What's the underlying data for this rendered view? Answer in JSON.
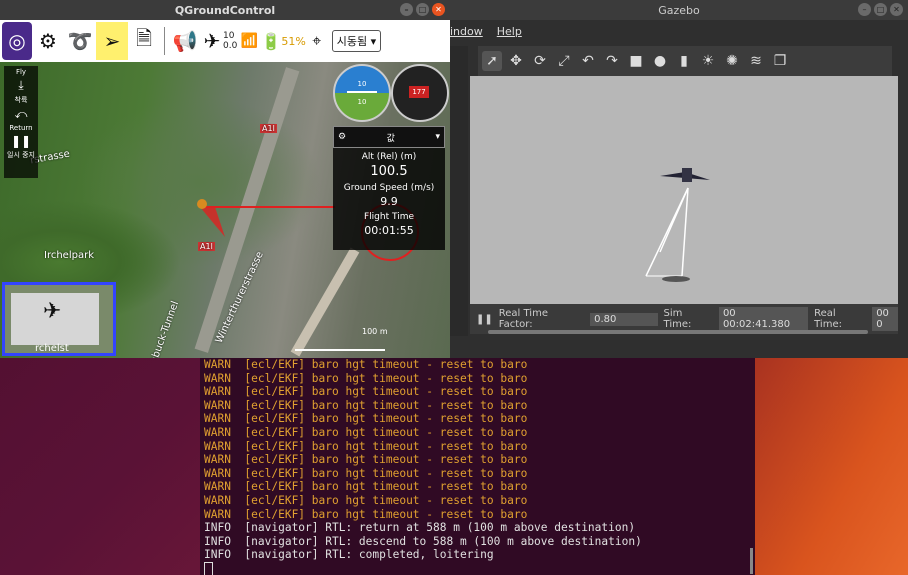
{
  "qgc": {
    "title": "QGroundControl",
    "toolbar": {
      "sat_count": "10",
      "hdop": "0.0",
      "battery": "51%",
      "mode": "시동됨"
    },
    "fly_panel": {
      "fly": "Fly",
      "takeoff": "착륙",
      "return": "Return",
      "pause": "일시 중지"
    },
    "values": {
      "header": "값",
      "alt_label": "Alt (Rel) (m)",
      "alt_value": "100.5",
      "speed_label": "Ground Speed (m/s)",
      "speed_value": "9.9",
      "time_label": "Flight Time",
      "time_value": "00:01:55"
    },
    "attitude": {
      "top": "10",
      "bottom": "10"
    },
    "compass": {
      "heading": "177"
    },
    "map_labels": {
      "street1": "rstrasse",
      "park": "Irchelpark",
      "tunnel": "hbuck-Tunnel",
      "street2": "Winterthurerstrasse",
      "a1l_1": "A1l",
      "a1l_2": "A1l",
      "pip_label": "rchelst",
      "scale": "100 m"
    }
  },
  "gazebo": {
    "title": "Gazebo",
    "menu": {
      "window": "indow",
      "help": "Help"
    },
    "status": {
      "rtf_label": "Real Time Factor:",
      "rtf_value": "0.80",
      "sim_label": "Sim Time:",
      "sim_value": "00 00:02:41.380",
      "real_label": "Real Time:",
      "real_value": "00 0"
    }
  },
  "terminal": {
    "lines": [
      {
        "level": "WARN",
        "text": "  [ecl/EKF] baro hgt timeout - reset to baro"
      },
      {
        "level": "WARN",
        "text": "  [ecl/EKF] baro hgt timeout - reset to baro"
      },
      {
        "level": "WARN",
        "text": "  [ecl/EKF] baro hgt timeout - reset to baro"
      },
      {
        "level": "WARN",
        "text": "  [ecl/EKF] baro hgt timeout - reset to baro"
      },
      {
        "level": "WARN",
        "text": "  [ecl/EKF] baro hgt timeout - reset to baro"
      },
      {
        "level": "WARN",
        "text": "  [ecl/EKF] baro hgt timeout - reset to baro"
      },
      {
        "level": "WARN",
        "text": "  [ecl/EKF] baro hgt timeout - reset to baro"
      },
      {
        "level": "WARN",
        "text": "  [ecl/EKF] baro hgt timeout - reset to baro"
      },
      {
        "level": "WARN",
        "text": "  [ecl/EKF] baro hgt timeout - reset to baro"
      },
      {
        "level": "WARN",
        "text": "  [ecl/EKF] baro hgt timeout - reset to baro"
      },
      {
        "level": "WARN",
        "text": "  [ecl/EKF] baro hgt timeout - reset to baro"
      },
      {
        "level": "WARN",
        "text": "  [ecl/EKF] baro hgt timeout - reset to baro"
      },
      {
        "level": "INFO",
        "text": "  [navigator] RTL: return at 588 m (100 m above destination)"
      },
      {
        "level": "INFO",
        "text": "  [navigator] RTL: descend to 588 m (100 m above destination)"
      },
      {
        "level": "INFO",
        "text": "  [navigator] RTL: completed, loitering"
      }
    ]
  }
}
